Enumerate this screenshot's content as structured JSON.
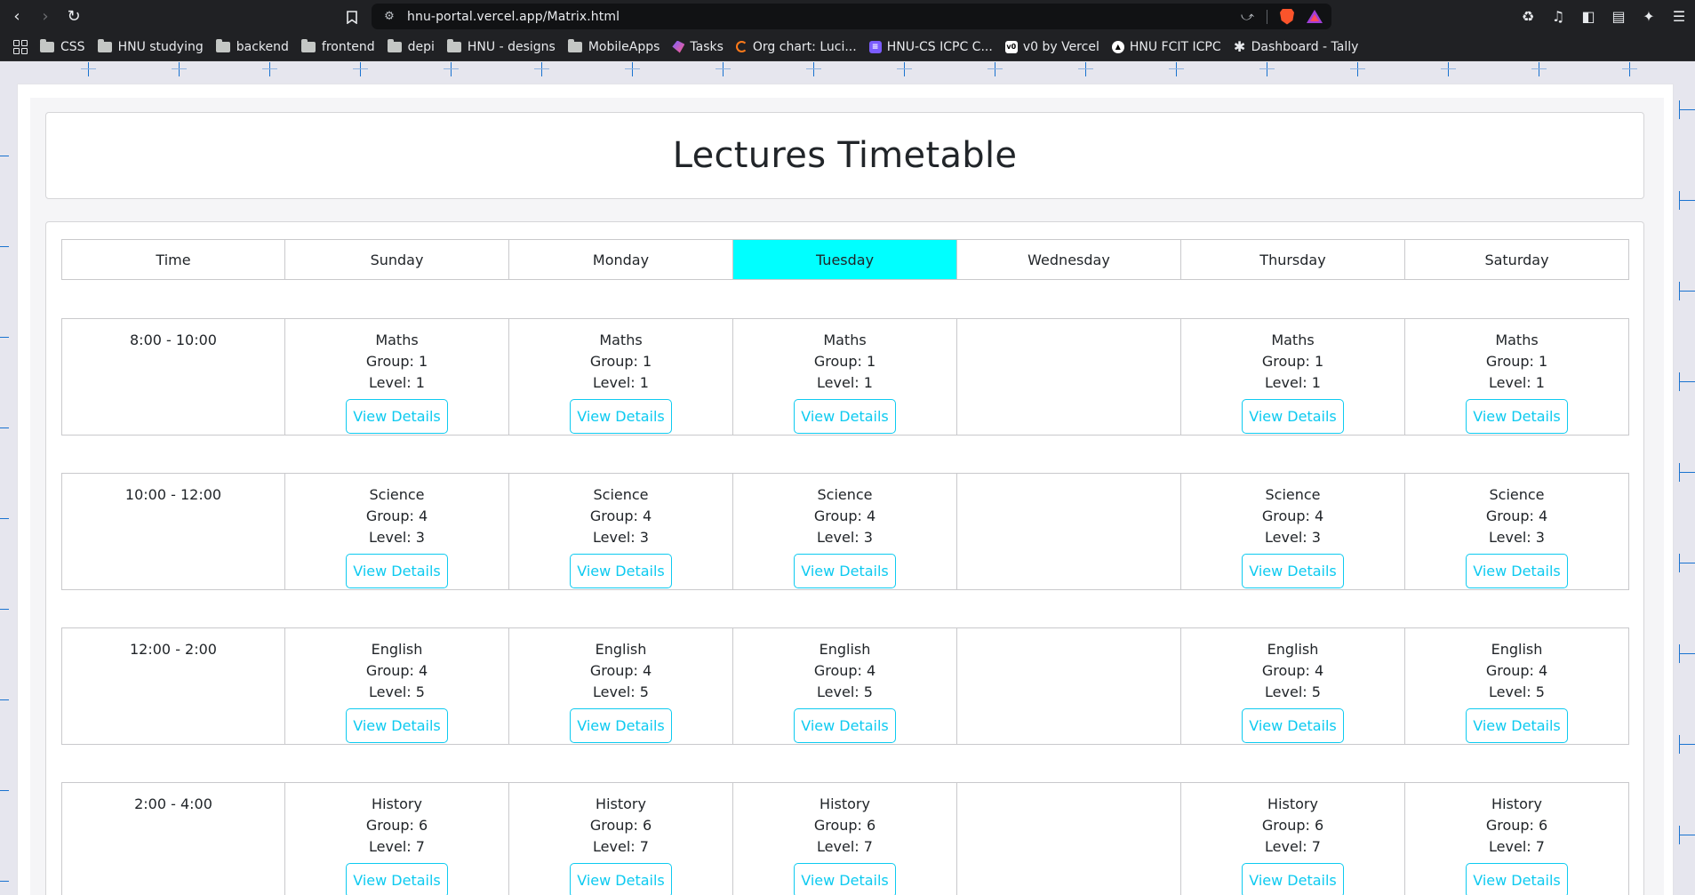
{
  "browser": {
    "url": "hnu-portal.vercel.app/Matrix.html",
    "bookmarks": [
      {
        "label": "CSS",
        "icon": "folder-icon"
      },
      {
        "label": "HNU studying",
        "icon": "folder-icon"
      },
      {
        "label": "backend",
        "icon": "folder-icon"
      },
      {
        "label": "frontend",
        "icon": "folder-icon"
      },
      {
        "label": "depi",
        "icon": "folder-icon"
      },
      {
        "label": "HNU - designs",
        "icon": "folder-icon"
      },
      {
        "label": "MobileApps",
        "icon": "folder-icon"
      },
      {
        "label": "Tasks",
        "icon": "tasks-favicon"
      },
      {
        "label": "Org chart: Luci...",
        "icon": "org-chart-favicon"
      },
      {
        "label": "HNU-CS ICPC C...",
        "icon": "icpc-favicon"
      },
      {
        "label": "v0 by Vercel",
        "icon": "v0-favicon"
      },
      {
        "label": "HNU FCIT ICPC",
        "icon": "fcit-favicon"
      },
      {
        "label": "Dashboard - Tally",
        "icon": "tally-favicon"
      }
    ]
  },
  "page": {
    "title": "Lectures Timetable",
    "accent_color": "#0dcaf0",
    "highlight_color": "#00ffff"
  },
  "timetable": {
    "header": [
      "Time",
      "Sunday",
      "Monday",
      "Tuesday",
      "Wednesday",
      "Thursday",
      "Saturday"
    ],
    "active_day": "Tuesday",
    "rows": [
      {
        "time": "8:00 - 10:00",
        "cells": [
          {
            "subject": "Maths",
            "group": "Group: 1",
            "level": "Level: 1",
            "button": "View Details"
          },
          {
            "subject": "Maths",
            "group": "Group: 1",
            "level": "Level: 1",
            "button": "View Details"
          },
          {
            "subject": "Maths",
            "group": "Group: 1",
            "level": "Level: 1",
            "button": "View Details"
          },
          null,
          {
            "subject": "Maths",
            "group": "Group: 1",
            "level": "Level: 1",
            "button": "View Details"
          },
          {
            "subject": "Maths",
            "group": "Group: 1",
            "level": "Level: 1",
            "button": "View Details"
          }
        ]
      },
      {
        "time": "10:00 - 12:00",
        "cells": [
          {
            "subject": "Science",
            "group": "Group: 4",
            "level": "Level: 3",
            "button": "View Details"
          },
          {
            "subject": "Science",
            "group": "Group: 4",
            "level": "Level: 3",
            "button": "View Details"
          },
          {
            "subject": "Science",
            "group": "Group: 4",
            "level": "Level: 3",
            "button": "View Details"
          },
          null,
          {
            "subject": "Science",
            "group": "Group: 4",
            "level": "Level: 3",
            "button": "View Details"
          },
          {
            "subject": "Science",
            "group": "Group: 4",
            "level": "Level: 3",
            "button": "View Details"
          }
        ]
      },
      {
        "time": "12:00 - 2:00",
        "cells": [
          {
            "subject": "English",
            "group": "Group: 4",
            "level": "Level: 5",
            "button": "View Details"
          },
          {
            "subject": "English",
            "group": "Group: 4",
            "level": "Level: 5",
            "button": "View Details"
          },
          {
            "subject": "English",
            "group": "Group: 4",
            "level": "Level: 5",
            "button": "View Details"
          },
          null,
          {
            "subject": "English",
            "group": "Group: 4",
            "level": "Level: 5",
            "button": "View Details"
          },
          {
            "subject": "English",
            "group": "Group: 4",
            "level": "Level: 5",
            "button": "View Details"
          }
        ]
      },
      {
        "time": "2:00 - 4:00",
        "cells": [
          {
            "subject": "History",
            "group": "Group: 6",
            "level": "Level: 7",
            "button": "View Details"
          },
          {
            "subject": "History",
            "group": "Group: 6",
            "level": "Level: 7",
            "button": "View Details"
          },
          {
            "subject": "History",
            "group": "Group: 6",
            "level": "Level: 7",
            "button": "View Details"
          },
          null,
          {
            "subject": "History",
            "group": "Group: 6",
            "level": "Level: 7",
            "button": "View Details"
          },
          {
            "subject": "History",
            "group": "Group: 6",
            "level": "Level: 7",
            "button": "View Details"
          }
        ]
      }
    ]
  }
}
